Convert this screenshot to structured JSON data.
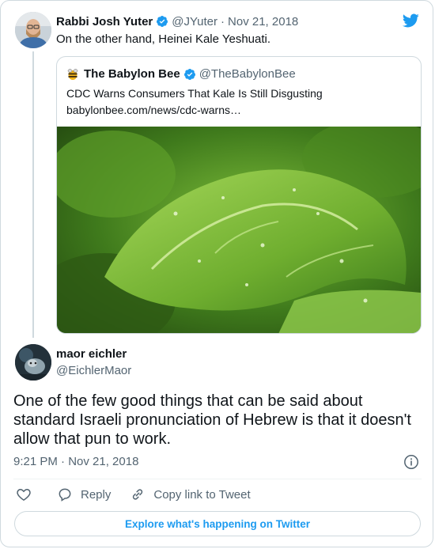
{
  "colors": {
    "accent": "#1d9bf0",
    "muted": "#536471",
    "border": "#cfd9de"
  },
  "parent_tweet": {
    "author_name": "Rabbi Josh Yuter",
    "verified": true,
    "handle": "@JYuter",
    "separator": "·",
    "date": "Nov 21, 2018",
    "text": "On the other hand, Heinei Kale Yeshuati."
  },
  "quoted_tweet": {
    "author_name": "The Babylon Bee",
    "verified": true,
    "handle": "@TheBabylonBee",
    "headline": "CDC Warns Consumers That Kale Is Still Disgusting",
    "link": "babylonbee.com/news/cdc-warns…",
    "image_subject": "kale-leaves-photo"
  },
  "reply_tweet": {
    "author_name": "maor eichler",
    "handle": "@EichlerMaor",
    "text": "One of the few good things that can be said about standard Israeli pronunciation of Hebrew is that it doesn't allow that pun to work.",
    "timestamp": "9:21 PM · Nov 21, 2018"
  },
  "actions": {
    "like_icon": "heart-icon",
    "reply_label": "Reply",
    "copy_link_label": "Copy link to Tweet"
  },
  "footer": {
    "explore_label": "Explore what's happening on Twitter"
  },
  "icons": [
    "twitter-bird-icon",
    "verified-badge-icon",
    "babylon-bee-logo",
    "info-icon",
    "heart-icon",
    "reply-icon",
    "link-icon"
  ]
}
